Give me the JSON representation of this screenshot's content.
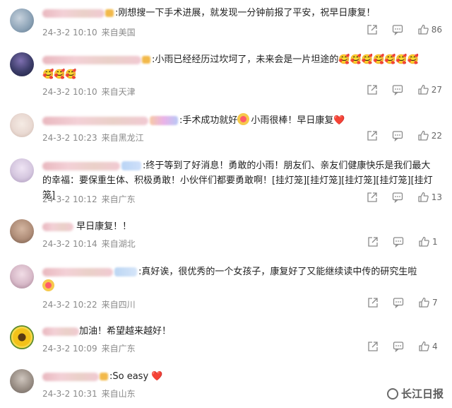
{
  "comments": [
    {
      "name_width": 88,
      "text": ":刚想搜一下手术进展，就发现一分钟前报了平安，祝早日康复！",
      "date": "24-3-2 10:10",
      "location": "来自美国",
      "likes": "86",
      "avatar_color": "#8aa1b5"
    },
    {
      "name_width": 140,
      "text": ":小雨已经经历过坎坷了，未来会是一片坦途的",
      "emoji_row1": "🥰🥰🥰🥰🥰🥰🥰",
      "emoji_row2": "🥰🥰🥰",
      "date": "24-3-2 10:10",
      "location": "来自天津",
      "likes": "27",
      "avatar_color": "#3b3c68"
    },
    {
      "name_width": 150,
      "text": ":手术成功就好",
      "text_after": "小雨很棒！早日康复",
      "heart": "❤️",
      "date": "24-3-2 10:23",
      "location": "来自黑龙江",
      "likes": "22",
      "avatar_color": "#e9d9d2"
    },
    {
      "name_width": 110,
      "text": ":终于等到了好消息！勇敢的小雨！朋友们、亲友们健康快乐是我们最大的幸福：要保重生体、积极勇敢！小伙伴们都要勇敢啊！[挂灯笼][挂灯笼][挂灯笼][挂灯笼][挂灯笼]",
      "date": "24-3-2 10:12",
      "location": "来自广东",
      "likes": "13",
      "avatar_color": "#d5c7df"
    },
    {
      "name_width": 44,
      "text": "早日康复！！",
      "date": "24-3-2 10:14",
      "location": "来自湖北",
      "likes": "1",
      "avatar_color": "#b08e79"
    },
    {
      "name_width": 100,
      "text": ":真好诶，很优秀的一个女孩子，康复好了又能继续读中传的研究生啦",
      "date": "24-3-2 10:22",
      "location": "来自四川",
      "likes": "7",
      "avatar_color": "#d7b9c8"
    },
    {
      "name_width": 52,
      "text": "加油！希望越来越好！",
      "date": "24-3-2 10:09",
      "location": "来自广东",
      "likes": "4",
      "avatar_color": "#e8b41c"
    },
    {
      "name_width": 80,
      "text": ":So easy",
      "heart": "❤️",
      "date": "24-3-2 10:31",
      "location": "来自山东",
      "likes": "",
      "avatar_color": "#9a8f86"
    }
  ],
  "watermark": "长江日报"
}
